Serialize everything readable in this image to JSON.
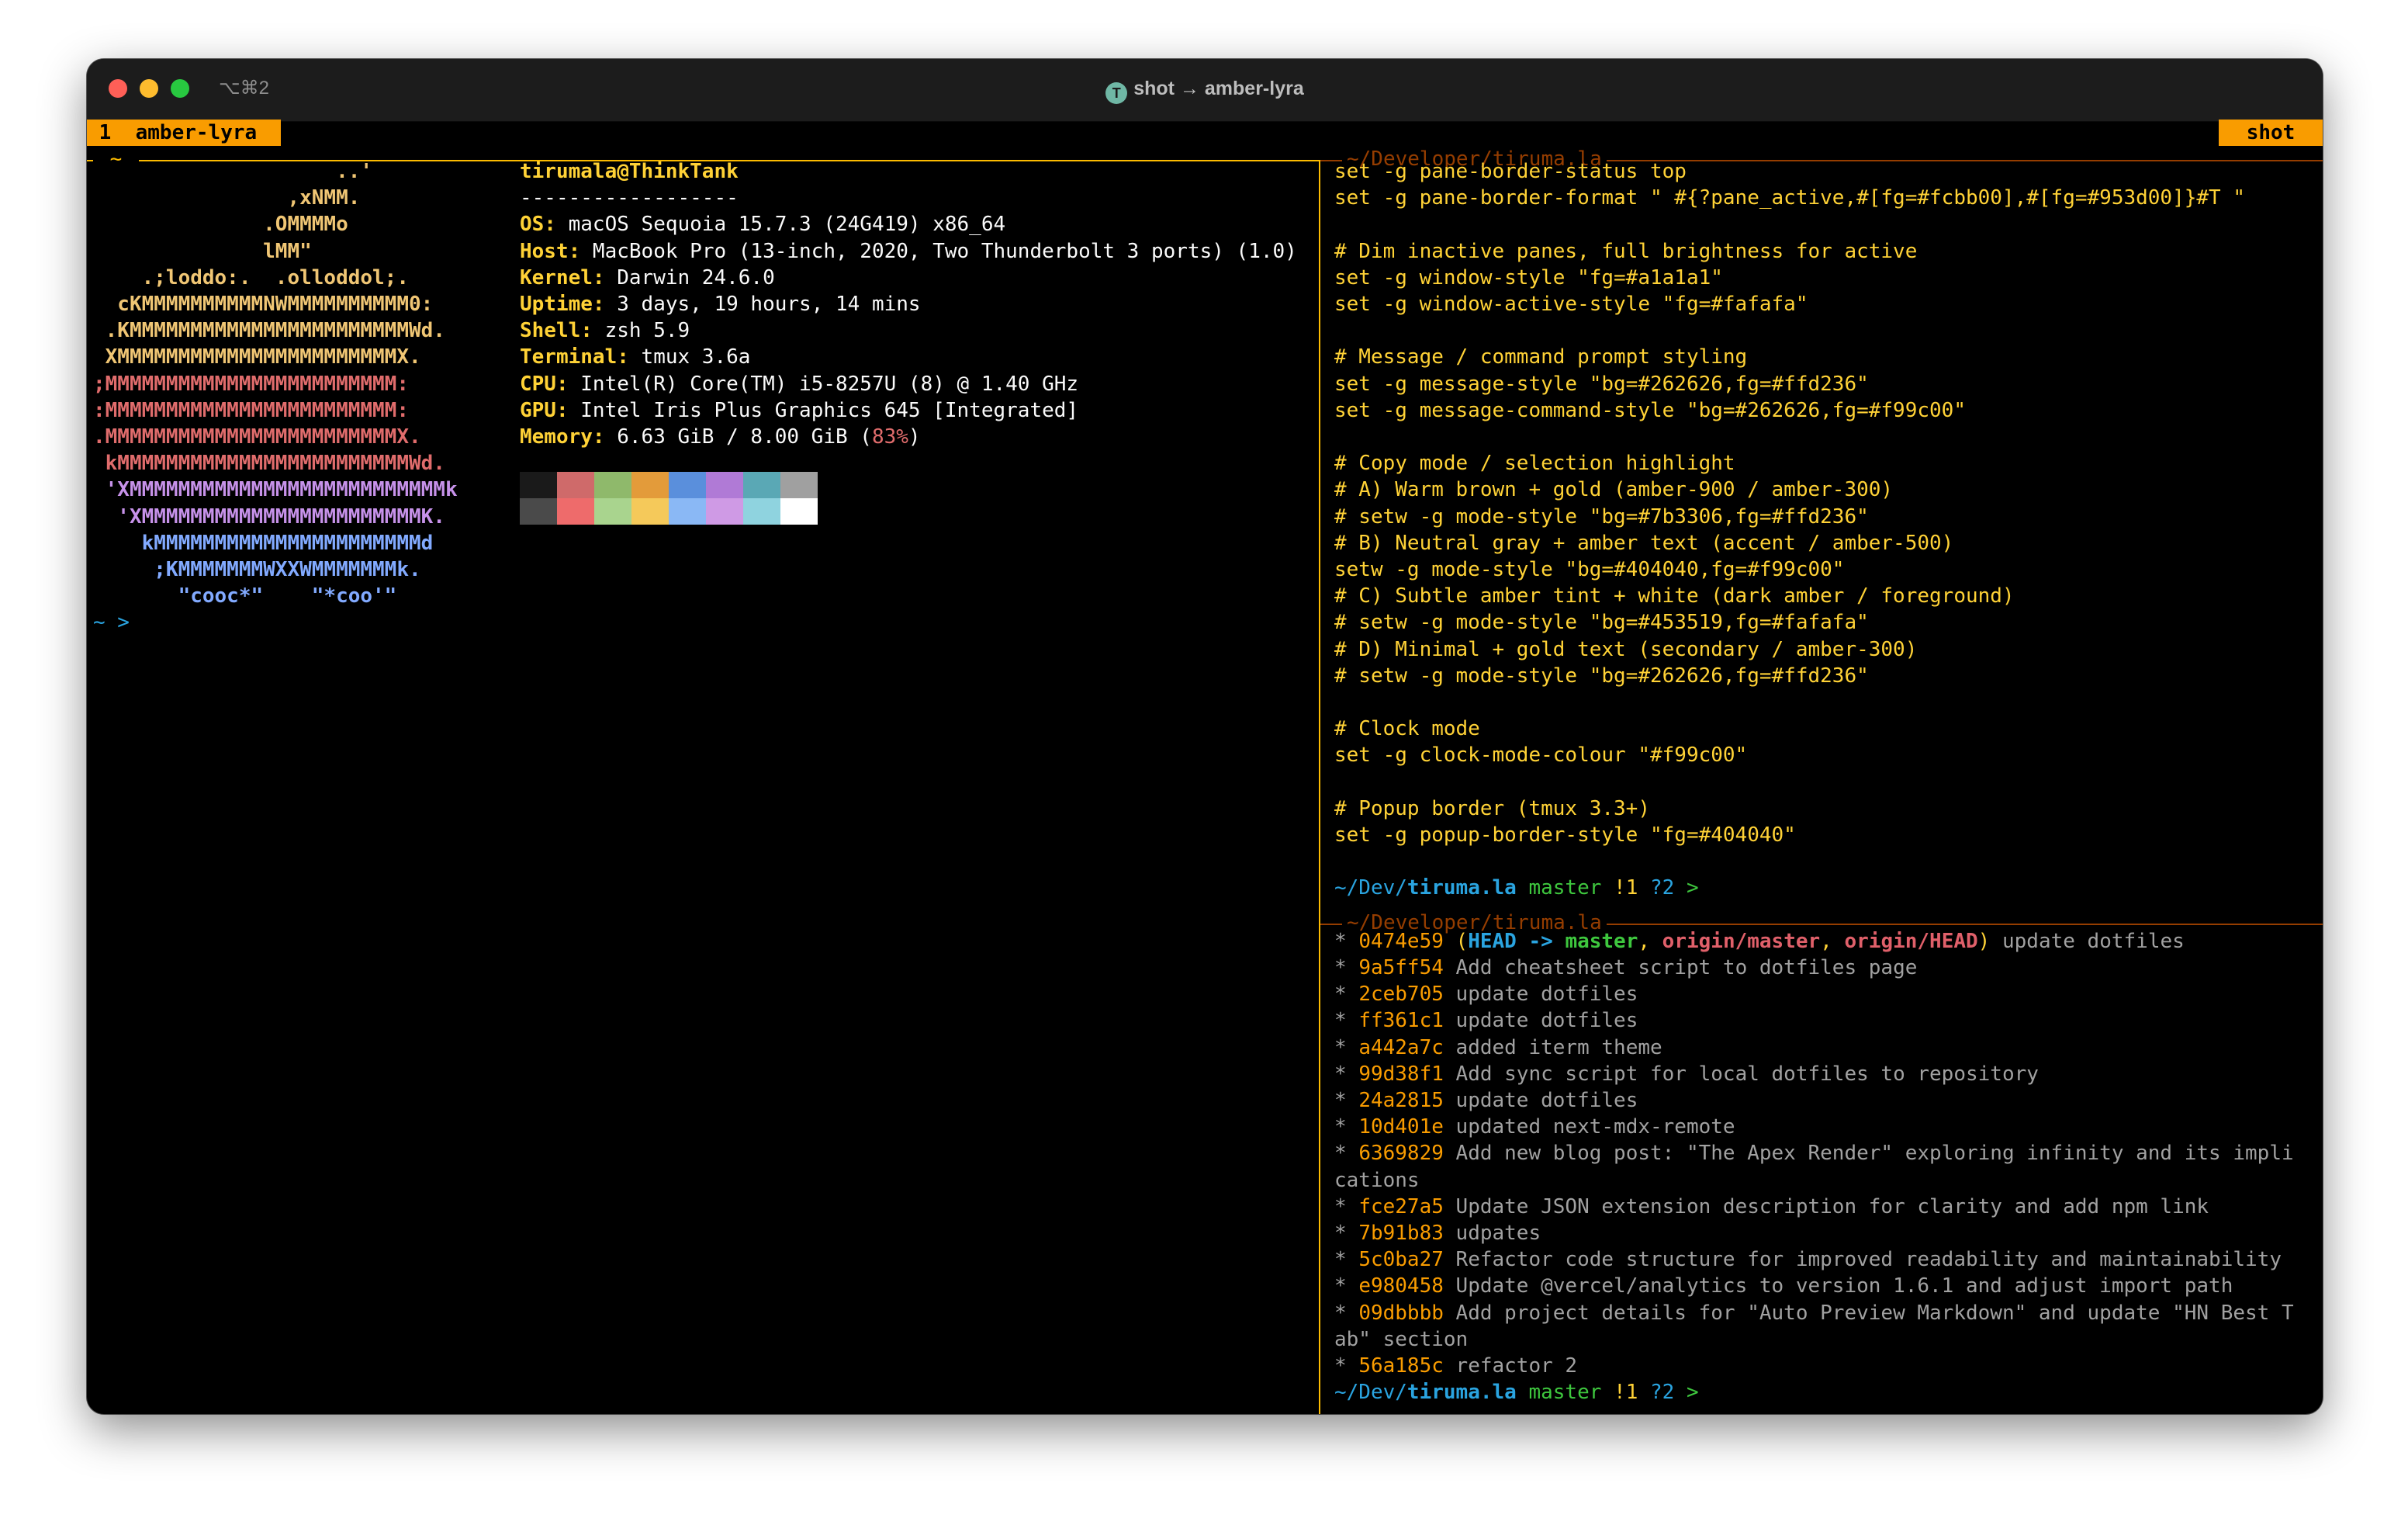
{
  "window": {
    "shortcut": "⌥⌘2",
    "title": "shot → amber-lyra",
    "title_icon": "T"
  },
  "tmux": {
    "window_index": "1",
    "window_name": "amber-lyra",
    "session_name": "shot",
    "colors": {
      "accent": "#f99c00",
      "border_active": "#fcbb00",
      "border_inactive": "#953d00"
    }
  },
  "left_pane": {
    "border_label": "~",
    "ascii_logo": [
      "                    ..'",
      "                ,xNMM.",
      "              .OMMMMo",
      "              lMM\"",
      "    .;loddo:.  .olloddol;.",
      "  cKMMMMMMMMMMNWMMMMMMMMMM0:",
      " .KMMMMMMMMMMMMMMMMMMMMMMMWd.",
      " XMMMMMMMMMMMMMMMMMMMMMMMX.",
      ";MMMMMMMMMMMMMMMMMMMMMMMM:",
      ":MMMMMMMMMMMMMMMMMMMMMMMM:",
      ".MMMMMMMMMMMMMMMMMMMMMMMMX.",
      " kMMMMMMMMMMMMMMMMMMMMMMMMWd.",
      " 'XMMMMMMMMMMMMMMMMMMMMMMMMMMk",
      "  'XMMMMMMMMMMMMMMMMMMMMMMMK.",
      "    kMMMMMMMMMMMMMMMMMMMMMMd",
      "     ;KMMMMMMMWXXWMMMMMMMk.",
      "       \"cooc*\"    \"*coo'\""
    ],
    "logo_colors": [
      "#f0c674",
      "#f0c674",
      "#f0c674",
      "#f0c674",
      "#f0c674",
      "#f0c674",
      "#f0c674",
      "#f0c674",
      "#e06c6c",
      "#e06c6c",
      "#e06c6c",
      "#e06c6c",
      "#c792ea",
      "#c792ea",
      "#82aaff",
      "#82aaff",
      "#82aaff"
    ],
    "user_host": "tirumala@ThinkTank",
    "separator": "------------------",
    "info": [
      {
        "key": "OS",
        "value": " macOS Sequoia 15.7.3 (24G419) x86_64"
      },
      {
        "key": "Host",
        "value": " MacBook Pro (13-inch, 2020, Two Thunderbolt 3 ports) (1.0)"
      },
      {
        "key": "Kernel",
        "value": " Darwin 24.6.0"
      },
      {
        "key": "Uptime",
        "value": " 3 days, 19 hours, 14 mins"
      },
      {
        "key": "Shell",
        "value": " zsh 5.9"
      },
      {
        "key": "Terminal",
        "value": " tmux 3.6a"
      },
      {
        "key": "CPU",
        "value": " Intel(R) Core(TM) i5-8257U (8) @ 1.40 GHz"
      },
      {
        "key": "GPU",
        "value": " Intel Iris Plus Graphics 645 [Integrated]"
      },
      {
        "key": "Memory",
        "value": " 6.63 GiB / 8.00 GiB (",
        "extra": "83%",
        "tail": ")"
      }
    ],
    "palette_top": [
      "#1a1a1a",
      "#cf6a6a",
      "#8fb96b",
      "#e39b3a",
      "#5a8fdc",
      "#b07ad6",
      "#5aa8b5",
      "#a0a0a0"
    ],
    "palette_bottom": [
      "#4a4a4a",
      "#ee6b6b",
      "#a9d48e",
      "#f5c95a",
      "#8ab8f5",
      "#cf9ae5",
      "#8fd3df",
      "#ffffff"
    ],
    "prompt": "~ >"
  },
  "right_top": {
    "border_label": "~/Developer/tiruma.la",
    "lines": [
      {
        "text": "set -g pane-border-status top",
        "cls": "c-gold"
      },
      {
        "text": "set -g pane-border-format \" #{?pane_active,#[fg=#fcbb00],#[fg=#953d00]}#T \"",
        "cls": "c-gold"
      },
      {
        "text": "",
        "cls": ""
      },
      {
        "text": "# Dim inactive panes, full brightness for active",
        "cls": "c-gold"
      },
      {
        "text": "set -g window-style \"fg=#a1a1a1\"",
        "cls": "c-gold"
      },
      {
        "text": "set -g window-active-style \"fg=#fafafa\"",
        "cls": "c-gold"
      },
      {
        "text": "",
        "cls": ""
      },
      {
        "text": "# Message / command prompt styling",
        "cls": "c-gold"
      },
      {
        "text": "set -g message-style \"bg=#262626,fg=#ffd236\"",
        "cls": "c-gold"
      },
      {
        "text": "set -g message-command-style \"bg=#262626,fg=#f99c00\"",
        "cls": "c-gold"
      },
      {
        "text": "",
        "cls": ""
      },
      {
        "text": "# Copy mode / selection highlight",
        "cls": "c-gold"
      },
      {
        "text": "# A) Warm brown + gold (amber-900 / amber-300)",
        "cls": "c-gold"
      },
      {
        "text": "# setw -g mode-style \"bg=#7b3306,fg=#ffd236\"",
        "cls": "c-gold"
      },
      {
        "text": "# B) Neutral gray + amber text (accent / amber-500)",
        "cls": "c-gold"
      },
      {
        "text": "setw -g mode-style \"bg=#404040,fg=#f99c00\"",
        "cls": "c-gold"
      },
      {
        "text": "# C) Subtle amber tint + white (dark amber / foreground)",
        "cls": "c-gold"
      },
      {
        "text": "# setw -g mode-style \"bg=#453519,fg=#fafafa\"",
        "cls": "c-gold"
      },
      {
        "text": "# D) Minimal + gold text (secondary / amber-300)",
        "cls": "c-gold"
      },
      {
        "text": "# setw -g mode-style \"bg=#262626,fg=#ffd236\"",
        "cls": "c-gold"
      },
      {
        "text": "",
        "cls": ""
      },
      {
        "text": "# Clock mode",
        "cls": "c-gold"
      },
      {
        "text": "set -g clock-mode-colour \"#f99c00\"",
        "cls": "c-gold"
      },
      {
        "text": "",
        "cls": ""
      },
      {
        "text": "# Popup border (tmux 3.3+)",
        "cls": "c-gold"
      },
      {
        "text": "set -g popup-border-style \"fg=#404040\"",
        "cls": "c-gold"
      }
    ]
  },
  "prompt": {
    "dir_prefix": "~/Dev/",
    "dir_name": "tiruma.la",
    "branch": "master",
    "status": "!1 ?2",
    "arrow": ">"
  },
  "right_bottom": {
    "border_label": "~/Developer/tiruma.la",
    "commits": [
      {
        "hash": "0474e59",
        "refs": [
          {
            "t": "(",
            "c": "c-gold"
          },
          {
            "t": "HEAD -> ",
            "c": "c-blue-b"
          },
          {
            "t": "master",
            "c": "c-green-b"
          },
          {
            "t": ", ",
            "c": "c-gold"
          },
          {
            "t": "origin/master",
            "c": "c-red-b"
          },
          {
            "t": ", ",
            "c": "c-gold"
          },
          {
            "t": "origin/HEAD",
            "c": "c-red-b"
          },
          {
            "t": ")",
            "c": "c-gold"
          }
        ],
        "msg": " update dotfiles"
      },
      {
        "hash": "9a5ff54",
        "msg": " Add cheatsheet script to dotfiles page"
      },
      {
        "hash": "2ceb705",
        "msg": " update dotfiles"
      },
      {
        "hash": "ff361c1",
        "msg": " update dotfiles"
      },
      {
        "hash": "a442a7c",
        "msg": " added iterm theme"
      },
      {
        "hash": "99d38f1",
        "msg": " Add sync script for local dotfiles to repository"
      },
      {
        "hash": "24a2815",
        "msg": " update dotfiles"
      },
      {
        "hash": "10d401e",
        "msg": " updated next-mdx-remote"
      },
      {
        "hash": "6369829",
        "msg": " Add new blog post: \"The Apex Render\" exploring infinity and its impli",
        "wrap": "cations"
      },
      {
        "hash": "fce27a5",
        "msg": " Update JSON extension description for clarity and add npm link"
      },
      {
        "hash": "7b91b83",
        "msg": " udpates"
      },
      {
        "hash": "5c0ba27",
        "msg": " Refactor code structure for improved readability and maintainability"
      },
      {
        "hash": "e980458",
        "msg": " Update @vercel/analytics to version 1.6.1 and adjust import path"
      },
      {
        "hash": "09dbbbb",
        "msg": " Add project details for \"Auto Preview Markdown\" and update \"HN Best T",
        "wrap": "ab\" section"
      },
      {
        "hash": "56a185c",
        "msg": " refactor 2"
      }
    ]
  }
}
